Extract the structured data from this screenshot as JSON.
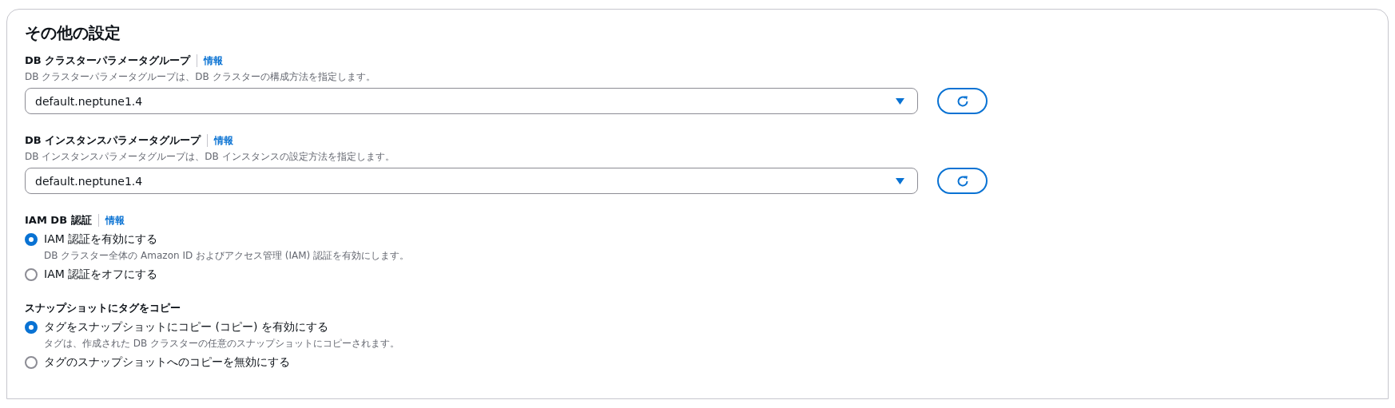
{
  "panel": {
    "title": "その他の設定",
    "sections": [
      {
        "kind": "select",
        "label": "DB クラスターパラメータグループ",
        "info": "情報",
        "description": "DB クラスターパラメータグループは、DB クラスターの構成方法を指定します。",
        "value": "default.neptune1.4"
      },
      {
        "kind": "select",
        "label": "DB インスタンスパラメータグループ",
        "info": "情報",
        "description": "DB インスタンスパラメータグループは、DB インスタンスの設定方法を指定します。",
        "value": "default.neptune1.4"
      },
      {
        "kind": "radio",
        "label": "IAM DB 認証",
        "info": "情報",
        "options": [
          {
            "label": "IAM 認証を有効にする",
            "description": "DB クラスター全体の Amazon ID およびアクセス管理 (IAM) 認証を有効にします。",
            "selected": true
          },
          {
            "label": "IAM 認証をオフにする",
            "selected": false
          }
        ]
      },
      {
        "kind": "radio",
        "label": "スナップショットにタグをコピー",
        "options": [
          {
            "label": "タグをスナップショットにコピー (コピー) を有効にする",
            "description": "タグは、作成された DB クラスターの任意のスナップショットにコピーされます。",
            "selected": true
          },
          {
            "label": "タグのスナップショットへのコピーを無効にする",
            "selected": false
          }
        ]
      }
    ]
  }
}
